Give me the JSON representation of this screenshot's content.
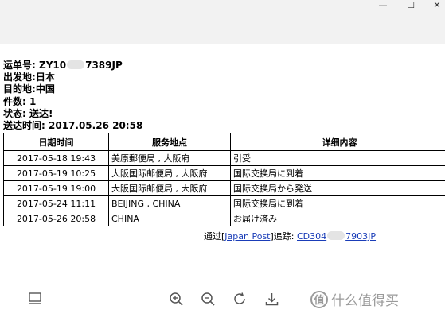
{
  "window": {
    "minimize": "—",
    "maximize": "☐",
    "close": "✕"
  },
  "info": {
    "tracking_label": "运单号:",
    "tracking_prefix": "ZY10",
    "tracking_suffix": "7389JP",
    "origin_label": "出发地:",
    "origin": "日本",
    "destination_label": "目的地:",
    "destination": "中国",
    "pieces_label": "件数:",
    "pieces": "1",
    "status_label": "状态:",
    "status": "送达!",
    "delivered_time_label": "送达时间:",
    "delivered_time": "2017.05.26 20:58"
  },
  "table": {
    "headers": [
      "日期时间",
      "服务地点",
      "详细内容"
    ],
    "rows": [
      [
        "2017-05-18 19:43",
        "美原郵便局 , 大阪府",
        "引受"
      ],
      [
        "2017-05-19 10:25",
        "大阪国际邮便局 , 大阪府",
        "国际交换局に到着"
      ],
      [
        "2017-05-19 19:00",
        "大阪国际邮便局 , 大阪府",
        "国际交换局から発送"
      ],
      [
        "2017-05-24 11:11",
        "BEIJING , CHINA",
        "国际交换局に到着"
      ],
      [
        "2017-05-26 20:58",
        "CHINA",
        "お届け済み"
      ]
    ]
  },
  "trace": {
    "prefix": "通过[",
    "link": "Japan Post",
    "middle": "]追踪: ",
    "code_prefix": "CD304",
    "code_suffix": "7903JP"
  },
  "toolbar": {
    "icons": [
      "presentation-icon",
      "zoom-in-icon",
      "zoom-out-icon",
      "rotate-icon",
      "download-icon"
    ]
  },
  "watermark": {
    "badge": "值",
    "text": "什么值得买"
  }
}
